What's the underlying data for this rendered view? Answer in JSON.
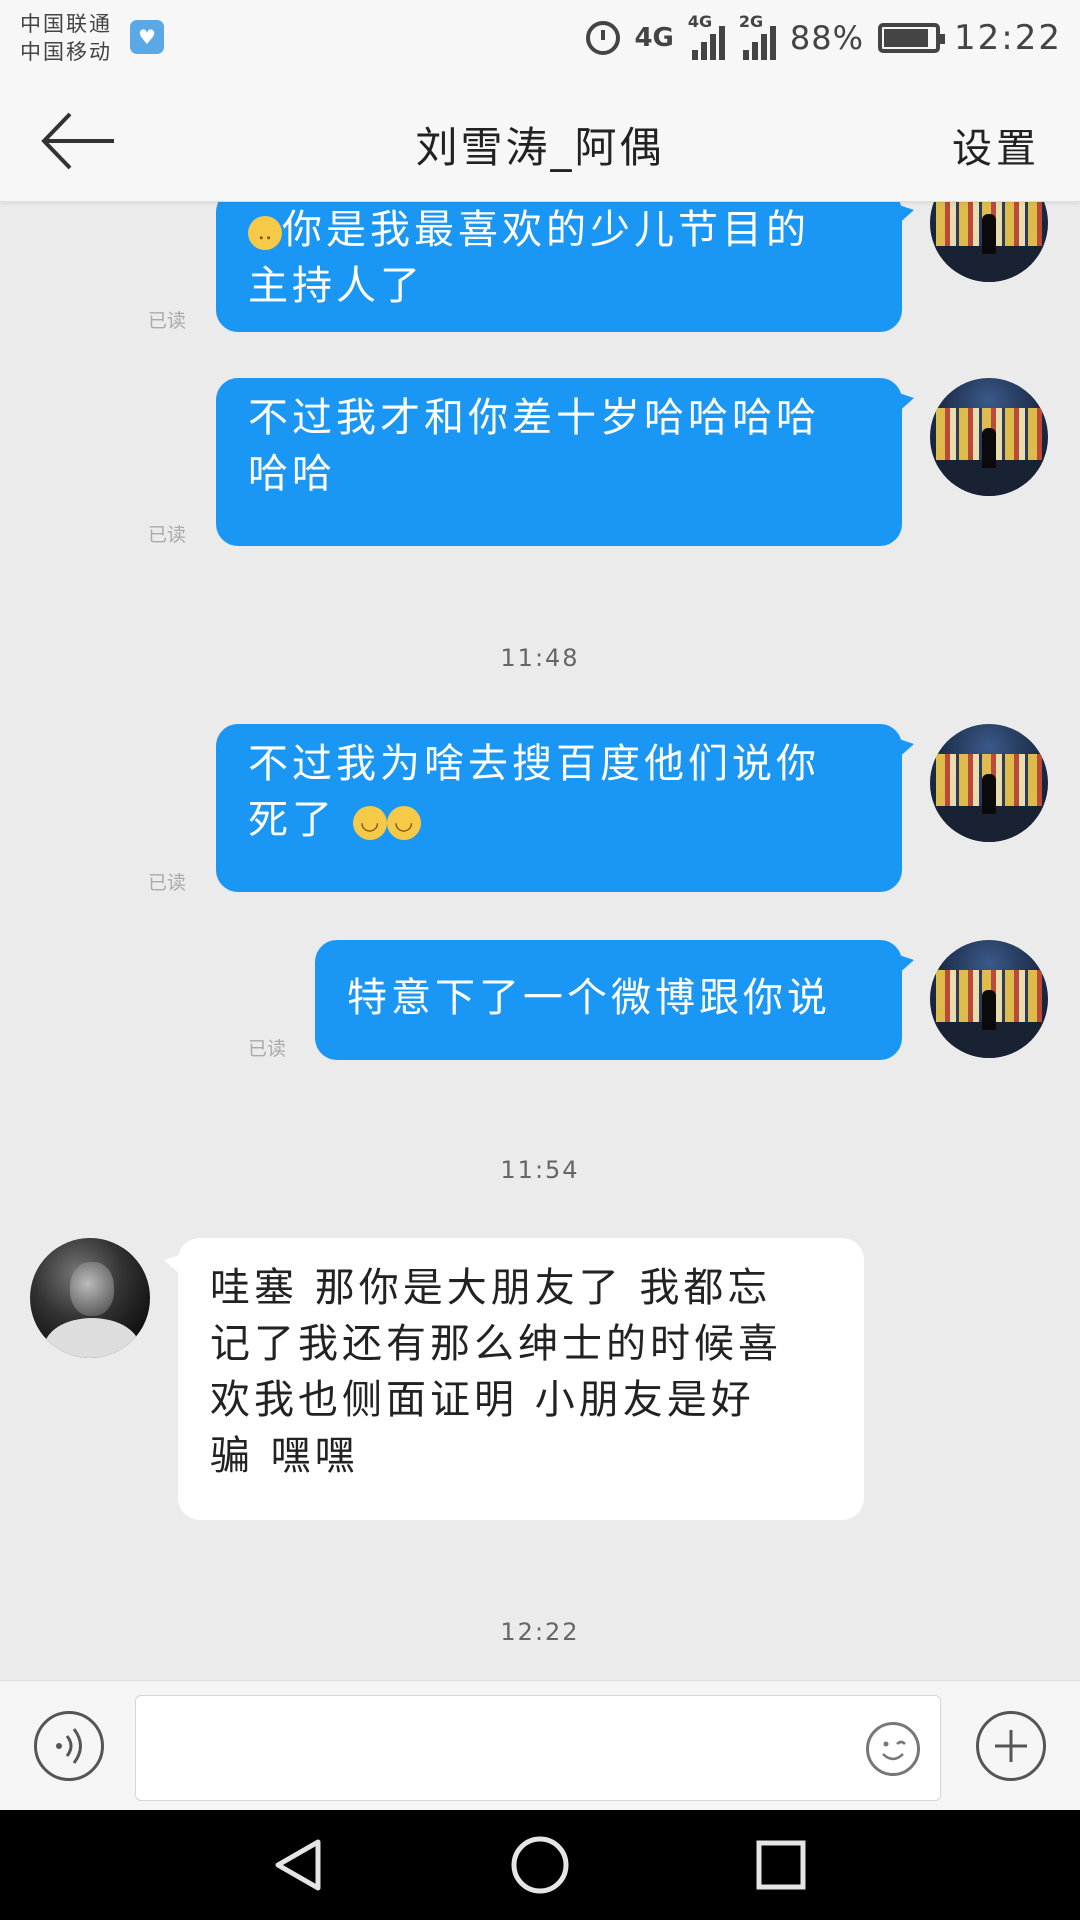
{
  "status_bar": {
    "carrier_1": "中国联通",
    "carrier_2": "中国移动",
    "network_1": "4G",
    "network_2": "4G",
    "network_3": "2G",
    "battery": "88%",
    "battery_level": 0.88,
    "time": "12:22"
  },
  "header": {
    "title": "刘雪涛_阿偶",
    "settings_label": "设置"
  },
  "messages": [
    {
      "direction": "out",
      "lines": [
        "你是我最喜欢的少儿节目的",
        "主持人了"
      ],
      "lead_emoji": "worried-face-emoji",
      "read": "已读"
    },
    {
      "direction": "out",
      "lines": [
        "不过我才和你差十岁哈哈哈哈",
        "哈哈"
      ],
      "read": "已读"
    },
    {
      "direction": "out",
      "lines": [
        "不过我为啥去搜百度他们说你",
        "死了"
      ],
      "trail_emoji": "laughing-tears-emoji x2",
      "read": "已读"
    },
    {
      "direction": "out",
      "lines": [
        "特意下了一个微博跟你说"
      ],
      "read": "已读"
    },
    {
      "direction": "in",
      "lines": [
        "哇塞  那你是大朋友了  我都忘",
        "记了我还有那么绅士的时候喜",
        "欢我也侧面证明  小朋友是好",
        "骗  嘿嘿"
      ]
    }
  ],
  "timestamps": [
    "11:48",
    "11:54",
    "12:22"
  ],
  "input": {
    "value": "",
    "placeholder": ""
  },
  "colors": {
    "outgoing_bubble": "#1a97f5",
    "incoming_bubble": "#ffffff",
    "background": "#ebebeb"
  }
}
